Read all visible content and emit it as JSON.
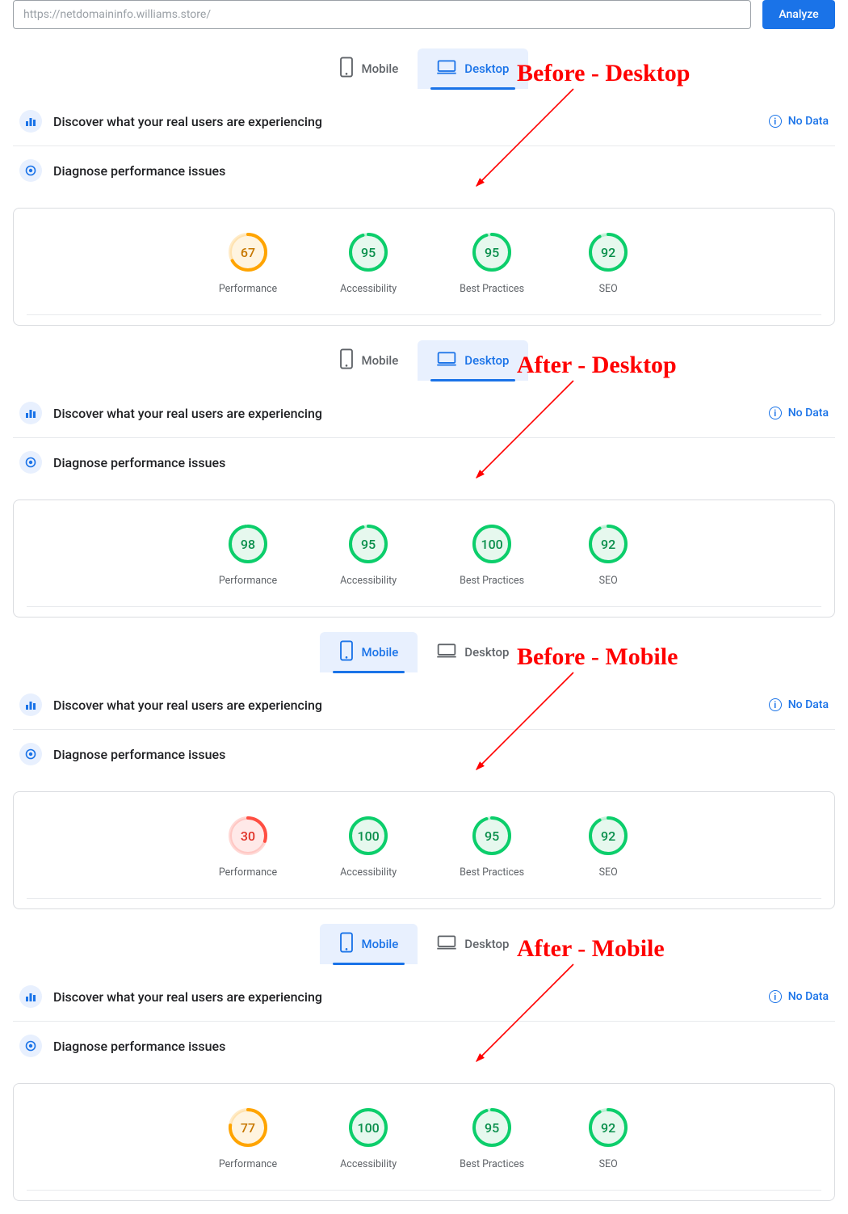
{
  "url_field": "https://netdomaininfo.williams.store/",
  "analyze_button": "Analyze",
  "tab_mobile": "Mobile",
  "tab_desktop": "Desktop",
  "discover_heading": "Discover what your real users are experiencing",
  "diagnose_heading": "Diagnose performance issues",
  "no_data": "No Data",
  "metric_labels": {
    "performance": "Performance",
    "accessibility": "Accessibility",
    "best_practices": "Best Practices",
    "seo": "SEO"
  },
  "annotations": {
    "before_desktop": "Before - Desktop",
    "after_desktop": "After - Desktop",
    "before_mobile": "Before - Mobile",
    "after_mobile": "After - Mobile"
  },
  "blocks": [
    {
      "active_tab": "desktop",
      "scores": {
        "performance": 67,
        "accessibility": 95,
        "best_practices": 95,
        "seo": 92
      }
    },
    {
      "active_tab": "desktop",
      "scores": {
        "performance": 98,
        "accessibility": 95,
        "best_practices": 100,
        "seo": 92
      }
    },
    {
      "active_tab": "mobile",
      "scores": {
        "performance": 30,
        "accessibility": 100,
        "best_practices": 95,
        "seo": 92
      }
    },
    {
      "active_tab": "mobile",
      "scores": {
        "performance": 77,
        "accessibility": 100,
        "best_practices": 95,
        "seo": 92
      }
    }
  ],
  "chart_data": [
    {
      "type": "gauge",
      "title": "Before - Desktop",
      "categories": [
        "Performance",
        "Accessibility",
        "Best Practices",
        "SEO"
      ],
      "values": [
        67,
        95,
        95,
        92
      ],
      "ylim": [
        0,
        100
      ]
    },
    {
      "type": "gauge",
      "title": "After - Desktop",
      "categories": [
        "Performance",
        "Accessibility",
        "Best Practices",
        "SEO"
      ],
      "values": [
        98,
        95,
        100,
        92
      ],
      "ylim": [
        0,
        100
      ]
    },
    {
      "type": "gauge",
      "title": "Before - Mobile",
      "categories": [
        "Performance",
        "Accessibility",
        "Best Practices",
        "SEO"
      ],
      "values": [
        30,
        100,
        95,
        92
      ],
      "ylim": [
        0,
        100
      ]
    },
    {
      "type": "gauge",
      "title": "After - Mobile",
      "categories": [
        "Performance",
        "Accessibility",
        "Best Practices",
        "SEO"
      ],
      "values": [
        77,
        100,
        95,
        92
      ],
      "ylim": [
        0,
        100
      ]
    }
  ]
}
